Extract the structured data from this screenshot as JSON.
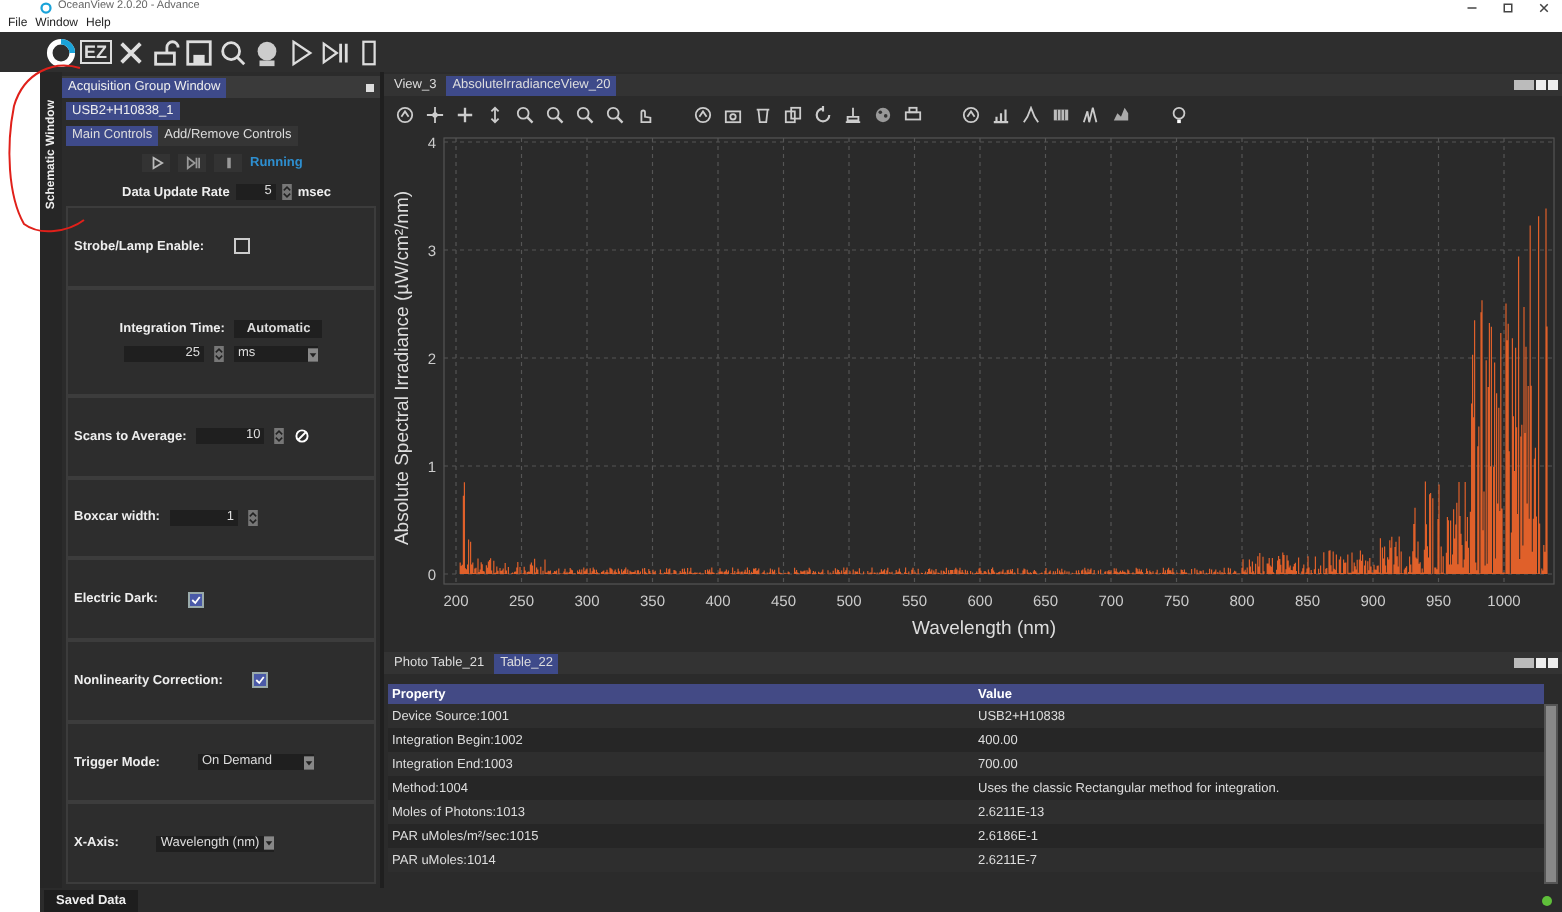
{
  "window": {
    "title": "OceanView 2.0.20 - Advance"
  },
  "menu": [
    "File",
    "Window",
    "Help"
  ],
  "toolbar": {
    "ez_label": "EZ"
  },
  "side_tab": "Schematic Window",
  "acquisition": {
    "title": "Acquisition Group Window",
    "device_tab": "USB2+H10838_1",
    "tabs": [
      {
        "label": "Main Controls",
        "selected": true
      },
      {
        "label": "Add/Remove Controls",
        "selected": false
      }
    ],
    "status": "Running",
    "update_rate": {
      "label": "Data Update Rate",
      "value": "5",
      "unit": "msec"
    },
    "controls": [
      {
        "kind": "checkbox",
        "label": "Strobe/Lamp Enable:",
        "checked": false
      },
      {
        "kind": "integration",
        "label": "Integration Time:",
        "mode": "Automatic",
        "value": "25",
        "unit": "ms"
      },
      {
        "kind": "spinner",
        "label": "Scans to Average:",
        "value": "10",
        "reset_button": true
      },
      {
        "kind": "spinner",
        "label": "Boxcar width:",
        "value": "1",
        "reset_button": false
      },
      {
        "kind": "checkbox",
        "label": "Electric Dark:",
        "checked": true
      },
      {
        "kind": "checkbox",
        "label": "Nonlinearity Correction:",
        "checked": true
      },
      {
        "kind": "dropdown",
        "label": "Trigger Mode:",
        "value": "On Demand"
      },
      {
        "kind": "dropdown",
        "label": "X-Axis:",
        "value": "Wavelength (nm)"
      }
    ]
  },
  "views": {
    "tabs": [
      {
        "label": "View_3",
        "selected": false
      },
      {
        "label": "AbsoluteIrradianceView_20",
        "selected": true
      }
    ]
  },
  "chart": {
    "xlabel": "Wavelength (nm)",
    "ylabel": "Absolute Spectral Irradiance (µW/cm²/nm)",
    "xticks": [
      "200",
      "250",
      "300",
      "350",
      "400",
      "450",
      "500",
      "550",
      "600",
      "650",
      "700",
      "750",
      "800",
      "850",
      "900",
      "950",
      "1000"
    ],
    "yticks": [
      "4",
      "3",
      "2",
      "1",
      "0"
    ]
  },
  "tables": {
    "tabs": [
      {
        "label": "Photo Table_21",
        "selected": false
      },
      {
        "label": "Table_22",
        "selected": true
      }
    ],
    "columns": [
      "Property",
      "Value"
    ],
    "rows": [
      [
        "Device Source:1001",
        "USB2+H10838"
      ],
      [
        "Integration Begin:1002",
        "400.00"
      ],
      [
        "Integration End:1003",
        "700.00"
      ],
      [
        "Method:1004",
        "Uses the classic Rectangular method for integration."
      ],
      [
        "Moles of Photons:1013",
        "2.6211E-13"
      ],
      [
        "PAR uMoles/m²/sec:1015",
        "2.6186E-1"
      ],
      [
        "PAR uMoles:1014",
        "2.6211E-7"
      ]
    ]
  },
  "status_bar": {
    "tab": "Saved Data",
    "connected": true
  }
}
